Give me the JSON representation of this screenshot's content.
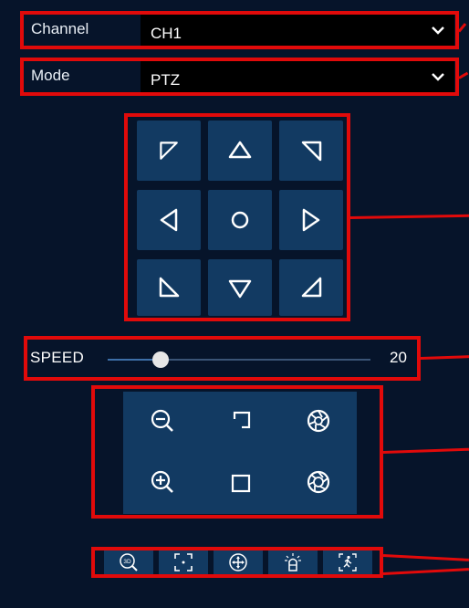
{
  "channel": {
    "label": "Channel",
    "value": "CH1"
  },
  "mode": {
    "label": "Mode",
    "value": "PTZ"
  },
  "speed": {
    "label": "SPEED",
    "value": "20",
    "level": 20,
    "max": 100
  },
  "icons": {
    "directions": [
      "arrow-up-left-icon",
      "arrow-up-icon",
      "arrow-up-right-icon",
      "arrow-left-icon",
      "center-circle-icon",
      "arrow-right-icon",
      "arrow-down-left-icon",
      "arrow-down-icon",
      "arrow-down-right-icon"
    ],
    "lens": [
      "zoom-out-icon",
      "focus-far-icon",
      "iris-close-icon",
      "zoom-in-icon",
      "focus-near-icon",
      "iris-open-icon"
    ],
    "tools": [
      "3d-zoom-icon",
      "focus-frame-icon",
      "pan-tilt-icon",
      "light-icon",
      "tracking-icon"
    ]
  },
  "colors": {
    "accent": "#e10a0a",
    "tile": "#123a62",
    "background": "#06142a"
  }
}
